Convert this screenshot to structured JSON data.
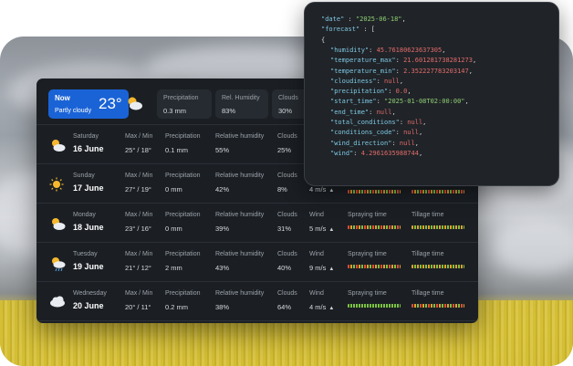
{
  "now": {
    "label": "Now",
    "condition": "Partly cloudy",
    "temp": "23°",
    "icon": "partly-cloudy-icon"
  },
  "current_stats": [
    {
      "label": "Precipitation",
      "value": "0.3 mm"
    },
    {
      "label": "Rel. Humidity",
      "value": "83%"
    },
    {
      "label": "Clouds",
      "value": "30%"
    }
  ],
  "columns": {
    "maxmin": "Max / Min",
    "precip": "Precipitation",
    "humidity": "Relative humidity",
    "clouds": "Clouds",
    "wind": "Wind",
    "spraying": "Spraying time",
    "tillage": "Tillage time"
  },
  "forecast": [
    {
      "day": "Saturday",
      "date": "16 June",
      "maxmin": "25° / 18°",
      "precip": "0.1 mm",
      "humidity": "55%",
      "clouds": "25%",
      "wind": "",
      "icon": "partly-cloudy-icon"
    },
    {
      "day": "Sunday",
      "date": "17 June",
      "maxmin": "27° / 19°",
      "precip": "0 mm",
      "humidity": "42%",
      "clouds": "8%",
      "wind": "4 m/s",
      "icon": "sun-icon"
    },
    {
      "day": "Monday",
      "date": "18 June",
      "maxmin": "23° / 16°",
      "precip": "0 mm",
      "humidity": "39%",
      "clouds": "31%",
      "wind": "5 m/s",
      "icon": "partly-cloudy-icon"
    },
    {
      "day": "Tuesday",
      "date": "19 June",
      "maxmin": "21° / 12°",
      "precip": "2 mm",
      "humidity": "43%",
      "clouds": "40%",
      "wind": "9 m/s",
      "icon": "sun-rain-icon"
    },
    {
      "day": "Wednesday",
      "date": "20 June",
      "maxmin": "20° / 11°",
      "precip": "0.2 mm",
      "humidity": "38%",
      "clouds": "64%",
      "wind": "4 m/s",
      "icon": "cloud-icon"
    }
  ],
  "json_lines": [
    {
      "k": "\"date\"",
      "p": " : ",
      "v": "\"2025-06-18\"",
      "t": "str",
      "e": ","
    },
    {
      "k": "\"forecast\"",
      "p": " : [",
      "v": "",
      "t": "",
      "e": ""
    },
    {
      "k": "",
      "p": "{",
      "v": "",
      "t": "",
      "e": ""
    },
    {
      "k": "\"humidity\"",
      "p": ": ",
      "v": "45.76180623637305",
      "t": "num",
      "e": ","
    },
    {
      "k": "\"temperature_max\"",
      "p": ": ",
      "v": "21.601281738281273",
      "t": "num",
      "e": ","
    },
    {
      "k": "\"temperature_min\"",
      "p": ": ",
      "v": "2.352227783203147",
      "t": "num",
      "e": ","
    },
    {
      "k": "\"cloudiness\"",
      "p": ": ",
      "v": "null",
      "t": "nul",
      "e": ","
    },
    {
      "k": "\"precipitation\"",
      "p": ": ",
      "v": "0.0",
      "t": "num",
      "e": ","
    },
    {
      "k": "\"start_time\"",
      "p": ": ",
      "v": "\"2025-01-08T02:00:00\"",
      "t": "str",
      "e": ","
    },
    {
      "k": "\"end_time\"",
      "p": ": ",
      "v": "null",
      "t": "nul",
      "e": ","
    },
    {
      "k": "\"total_conditions\"",
      "p": ": ",
      "v": "null",
      "t": "nul",
      "e": ","
    },
    {
      "k": "\"conditions_code\"",
      "p": ": ",
      "v": "null",
      "t": "nul",
      "e": ","
    },
    {
      "k": "\"wind_direction\"",
      "p": ": ",
      "v": "null",
      "t": "nul",
      "e": ","
    },
    {
      "k": "\"wind\"",
      "p": ": ",
      "v": "4.2961635988744",
      "t": "num",
      "e": ","
    }
  ],
  "colors": {
    "accent": "#1a63d6",
    "panel": "#1b1f24",
    "good": "#7bc142",
    "warn": "#e3a02a",
    "bad": "#e04c3c"
  }
}
